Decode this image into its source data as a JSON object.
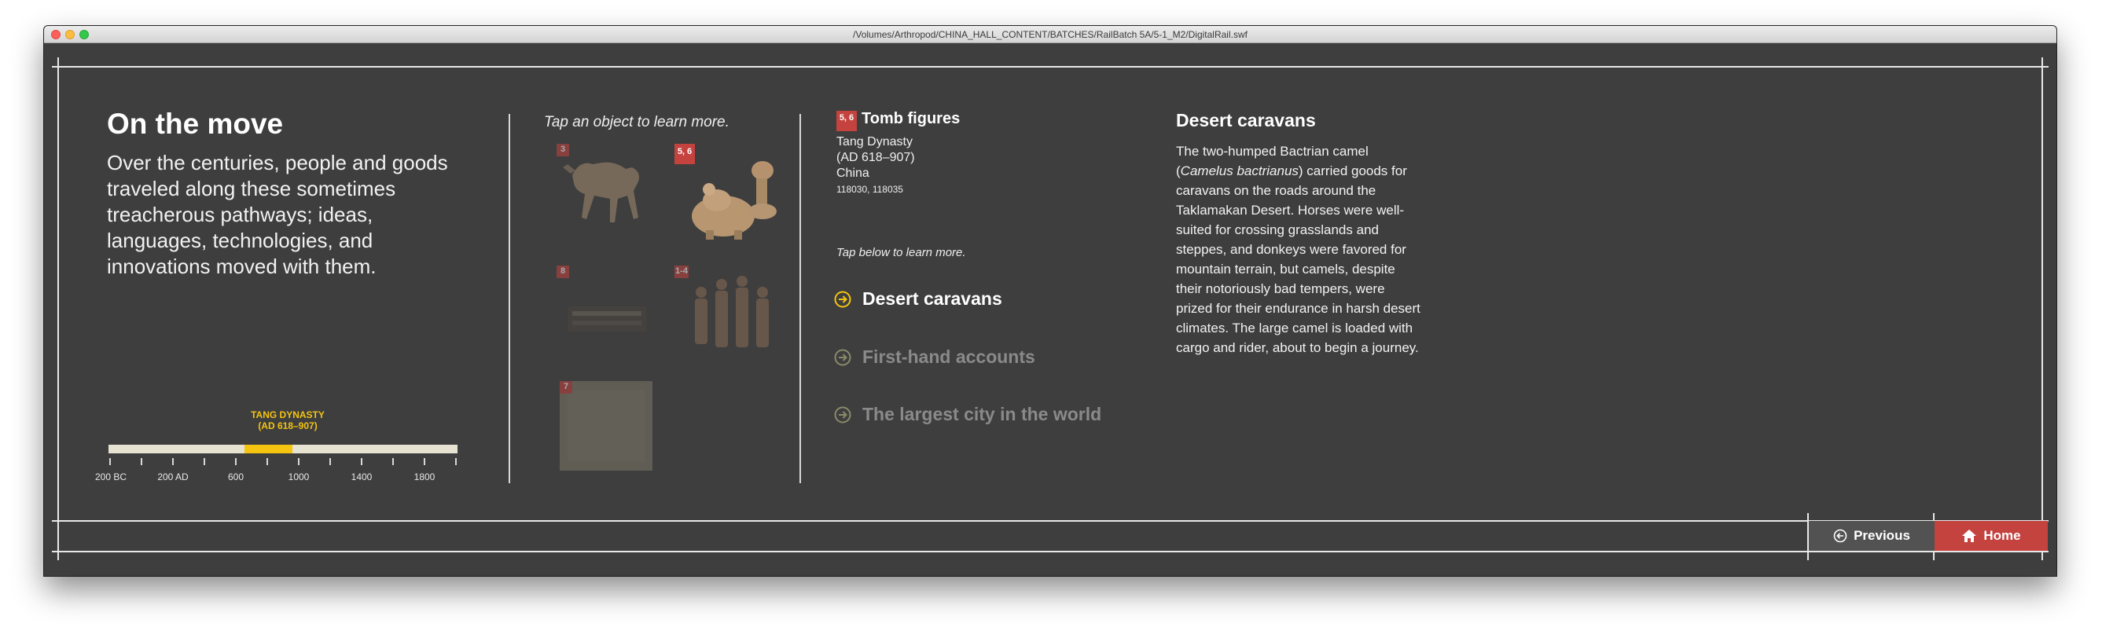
{
  "window": {
    "title": "/Volumes/Arthropod/CHINA_HALL_CONTENT/BATCHES/RailBatch 5A/5-1_M2/DigitalRail.swf"
  },
  "intro": {
    "heading": "On the move",
    "lines": [
      "Over the centuries, people and goods",
      "traveled along these sometimes",
      "treacherous pathways; ideas,",
      "languages, technologies, and",
      "innovations moved with them."
    ]
  },
  "timeline": {
    "era_name": "TANG DYNASTY",
    "era_dates": "(AD 618–907)",
    "highlight_range": [
      618,
      907
    ],
    "axis_range": [
      -200,
      1900
    ],
    "labels": [
      "200 BC",
      "200 AD",
      "600",
      "1000",
      "1400",
      "1800"
    ],
    "colors": {
      "highlight": "#f4c410",
      "bar": "#e7e3d3"
    }
  },
  "gallery": {
    "instruction": "Tap an object to learn more.",
    "objects": [
      {
        "badge": "3"
      },
      {
        "badge": "5, 6"
      },
      {
        "badge": "8"
      },
      {
        "badge": "1-4"
      },
      {
        "badge": "7"
      }
    ]
  },
  "object": {
    "badge": "5, 6",
    "title": "Tomb figures",
    "dynasty": "Tang Dynasty",
    "dates": "(AD 618–907)",
    "origin": "China",
    "catalog": "118030, 118035"
  },
  "topics": {
    "instruction": "Tap below to learn more.",
    "items": [
      {
        "label": "Desert caravans"
      },
      {
        "label": "First-hand accounts"
      },
      {
        "label": "The largest city in the world"
      }
    ]
  },
  "description": {
    "title": "Desert caravans",
    "line1": "The two-humped Bactrian camel",
    "line2_open": "(",
    "line2_species": "Camelus bactrianus",
    "line2_rest": ") carried goods for",
    "lines": [
      "caravans on the roads around the",
      "Taklamakan Desert. Horses were well-",
      "suited for crossing grasslands and",
      "steppes, and donkeys were favored for",
      "mountain terrain, but camels, despite",
      "their notoriously bad tempers, were",
      "prized for their endurance in harsh desert",
      "climates. The large camel is loaded with",
      "cargo and rider, about to begin a journey."
    ]
  },
  "nav": {
    "previous_label": "Previous",
    "home_label": "Home",
    "colors": {
      "home": "#c4433f",
      "previous": "#525252"
    }
  }
}
